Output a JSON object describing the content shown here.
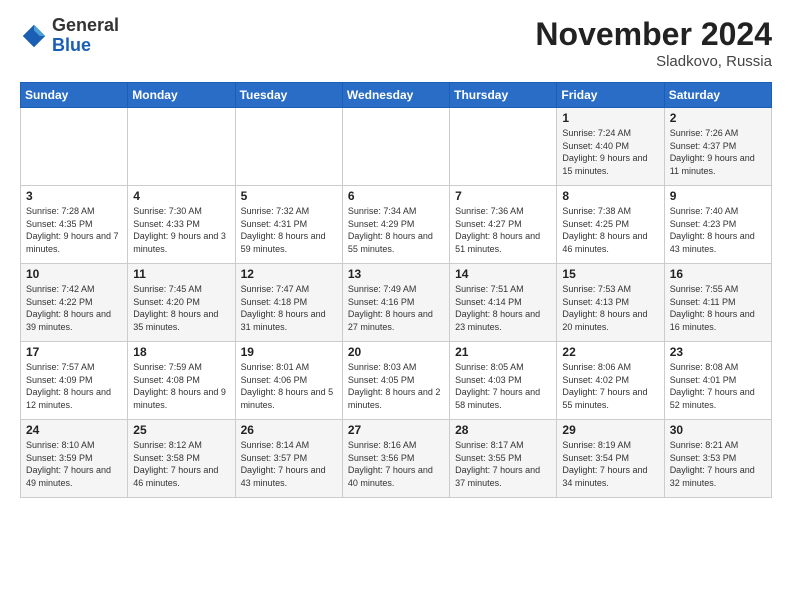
{
  "header": {
    "logo_line1": "General",
    "logo_line2": "Blue",
    "month_title": "November 2024",
    "location": "Sladkovo, Russia"
  },
  "weekdays": [
    "Sunday",
    "Monday",
    "Tuesday",
    "Wednesday",
    "Thursday",
    "Friday",
    "Saturday"
  ],
  "weeks": [
    [
      {
        "day": "",
        "info": ""
      },
      {
        "day": "",
        "info": ""
      },
      {
        "day": "",
        "info": ""
      },
      {
        "day": "",
        "info": ""
      },
      {
        "day": "",
        "info": ""
      },
      {
        "day": "1",
        "info": "Sunrise: 7:24 AM\nSunset: 4:40 PM\nDaylight: 9 hours and 15 minutes."
      },
      {
        "day": "2",
        "info": "Sunrise: 7:26 AM\nSunset: 4:37 PM\nDaylight: 9 hours and 11 minutes."
      }
    ],
    [
      {
        "day": "3",
        "info": "Sunrise: 7:28 AM\nSunset: 4:35 PM\nDaylight: 9 hours and 7 minutes."
      },
      {
        "day": "4",
        "info": "Sunrise: 7:30 AM\nSunset: 4:33 PM\nDaylight: 9 hours and 3 minutes."
      },
      {
        "day": "5",
        "info": "Sunrise: 7:32 AM\nSunset: 4:31 PM\nDaylight: 8 hours and 59 minutes."
      },
      {
        "day": "6",
        "info": "Sunrise: 7:34 AM\nSunset: 4:29 PM\nDaylight: 8 hours and 55 minutes."
      },
      {
        "day": "7",
        "info": "Sunrise: 7:36 AM\nSunset: 4:27 PM\nDaylight: 8 hours and 51 minutes."
      },
      {
        "day": "8",
        "info": "Sunrise: 7:38 AM\nSunset: 4:25 PM\nDaylight: 8 hours and 46 minutes."
      },
      {
        "day": "9",
        "info": "Sunrise: 7:40 AM\nSunset: 4:23 PM\nDaylight: 8 hours and 43 minutes."
      }
    ],
    [
      {
        "day": "10",
        "info": "Sunrise: 7:42 AM\nSunset: 4:22 PM\nDaylight: 8 hours and 39 minutes."
      },
      {
        "day": "11",
        "info": "Sunrise: 7:45 AM\nSunset: 4:20 PM\nDaylight: 8 hours and 35 minutes."
      },
      {
        "day": "12",
        "info": "Sunrise: 7:47 AM\nSunset: 4:18 PM\nDaylight: 8 hours and 31 minutes."
      },
      {
        "day": "13",
        "info": "Sunrise: 7:49 AM\nSunset: 4:16 PM\nDaylight: 8 hours and 27 minutes."
      },
      {
        "day": "14",
        "info": "Sunrise: 7:51 AM\nSunset: 4:14 PM\nDaylight: 8 hours and 23 minutes."
      },
      {
        "day": "15",
        "info": "Sunrise: 7:53 AM\nSunset: 4:13 PM\nDaylight: 8 hours and 20 minutes."
      },
      {
        "day": "16",
        "info": "Sunrise: 7:55 AM\nSunset: 4:11 PM\nDaylight: 8 hours and 16 minutes."
      }
    ],
    [
      {
        "day": "17",
        "info": "Sunrise: 7:57 AM\nSunset: 4:09 PM\nDaylight: 8 hours and 12 minutes."
      },
      {
        "day": "18",
        "info": "Sunrise: 7:59 AM\nSunset: 4:08 PM\nDaylight: 8 hours and 9 minutes."
      },
      {
        "day": "19",
        "info": "Sunrise: 8:01 AM\nSunset: 4:06 PM\nDaylight: 8 hours and 5 minutes."
      },
      {
        "day": "20",
        "info": "Sunrise: 8:03 AM\nSunset: 4:05 PM\nDaylight: 8 hours and 2 minutes."
      },
      {
        "day": "21",
        "info": "Sunrise: 8:05 AM\nSunset: 4:03 PM\nDaylight: 7 hours and 58 minutes."
      },
      {
        "day": "22",
        "info": "Sunrise: 8:06 AM\nSunset: 4:02 PM\nDaylight: 7 hours and 55 minutes."
      },
      {
        "day": "23",
        "info": "Sunrise: 8:08 AM\nSunset: 4:01 PM\nDaylight: 7 hours and 52 minutes."
      }
    ],
    [
      {
        "day": "24",
        "info": "Sunrise: 8:10 AM\nSunset: 3:59 PM\nDaylight: 7 hours and 49 minutes."
      },
      {
        "day": "25",
        "info": "Sunrise: 8:12 AM\nSunset: 3:58 PM\nDaylight: 7 hours and 46 minutes."
      },
      {
        "day": "26",
        "info": "Sunrise: 8:14 AM\nSunset: 3:57 PM\nDaylight: 7 hours and 43 minutes."
      },
      {
        "day": "27",
        "info": "Sunrise: 8:16 AM\nSunset: 3:56 PM\nDaylight: 7 hours and 40 minutes."
      },
      {
        "day": "28",
        "info": "Sunrise: 8:17 AM\nSunset: 3:55 PM\nDaylight: 7 hours and 37 minutes."
      },
      {
        "day": "29",
        "info": "Sunrise: 8:19 AM\nSunset: 3:54 PM\nDaylight: 7 hours and 34 minutes."
      },
      {
        "day": "30",
        "info": "Sunrise: 8:21 AM\nSunset: 3:53 PM\nDaylight: 7 hours and 32 minutes."
      }
    ]
  ]
}
